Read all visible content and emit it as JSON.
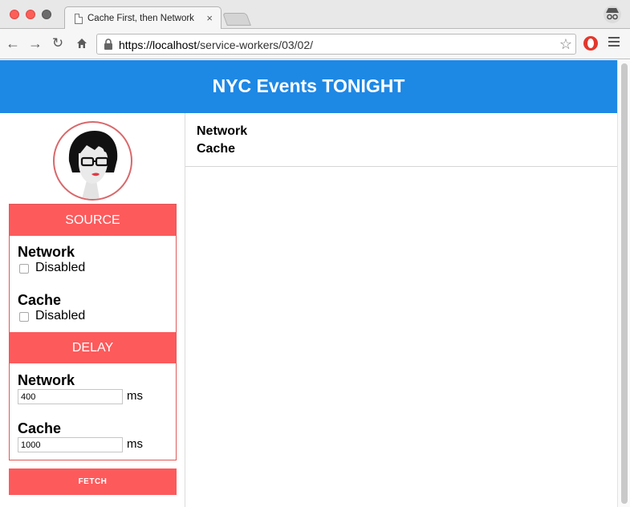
{
  "browser": {
    "tab_title": "Cache First, then Network",
    "tab_close": "×",
    "url_host": "https://localhost",
    "url_path": "/service-workers/03/02/"
  },
  "header": {
    "brand": "NYC",
    "title_rest": " Events TONIGHT",
    "background_color": "#1e88e5"
  },
  "sidebar": {
    "source": {
      "heading": "SOURCE",
      "items": [
        {
          "label": "Network",
          "checkbox_label": "Disabled",
          "checked": false
        },
        {
          "label": "Cache",
          "checkbox_label": "Disabled",
          "checked": false
        }
      ]
    },
    "delay": {
      "heading": "DELAY",
      "items": [
        {
          "label": "Network",
          "value": "400",
          "unit": "ms"
        },
        {
          "label": "Cache",
          "value": "1000",
          "unit": "ms"
        }
      ]
    },
    "fetch_label": "FETCH",
    "accent_color": "#fd5a5c"
  },
  "results": {
    "lines": [
      "Network",
      "Cache"
    ]
  },
  "icons": {
    "back": "back-arrow-icon",
    "forward": "forward-arrow-icon",
    "reload": "reload-icon",
    "home": "home-icon",
    "lock": "lock-icon",
    "star": "star-icon",
    "extension": "extension-icon",
    "menu": "menu-icon"
  }
}
